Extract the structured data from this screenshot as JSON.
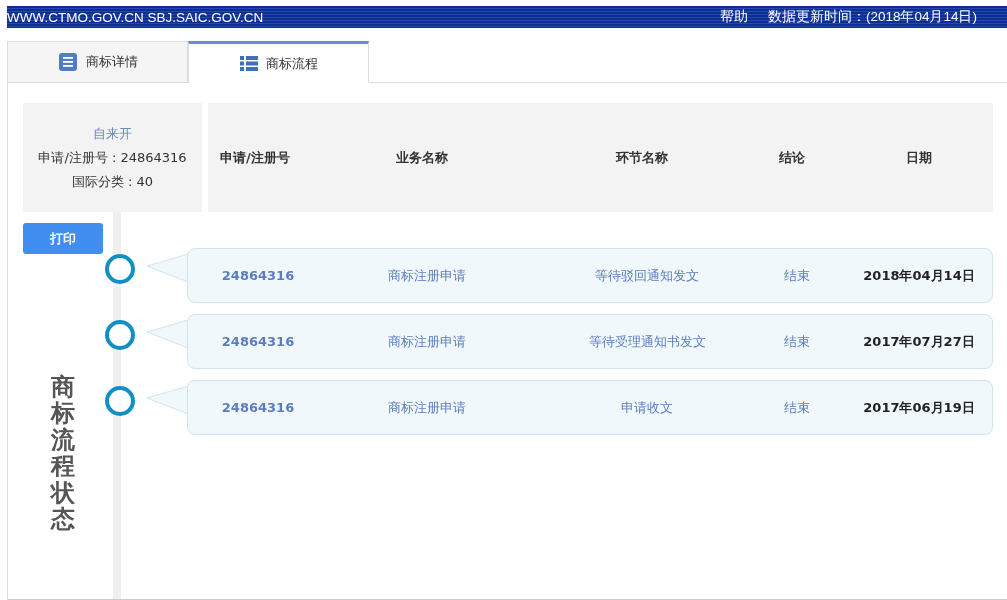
{
  "header": {
    "site": "WWW.CTMO.GOV.CN SBJ.SAIC.GOV.CN",
    "help": "帮助",
    "update_time": "数据更新时间：(2018年04月14日)"
  },
  "tabs": [
    {
      "label": "商标详情",
      "selected": false,
      "kind": "details"
    },
    {
      "label": "商标流程",
      "selected": true,
      "kind": "list"
    }
  ],
  "summary": {
    "name": "自来开",
    "reg_no": "申请/注册号 : 24864316",
    "class": "国际分类 : 40"
  },
  "table": {
    "columns": [
      "申请/注册号",
      "业务名称",
      "环节名称",
      "结论",
      "日期"
    ],
    "rows": [
      {
        "cells": [
          "24864316",
          "商标注册申请",
          "等待驳回通知发文",
          "结束",
          "2018年04月14日"
        ]
      },
      {
        "cells": [
          "24864316",
          "商标注册申请",
          "等待受理通知书发文",
          "结束",
          "2017年07月27日"
        ]
      },
      {
        "cells": [
          "24864316",
          "商标注册申请",
          "申请收文",
          "结束",
          "2017年06月19日"
        ]
      }
    ]
  },
  "print_button": "打印",
  "side_title": "商标流程状态"
}
